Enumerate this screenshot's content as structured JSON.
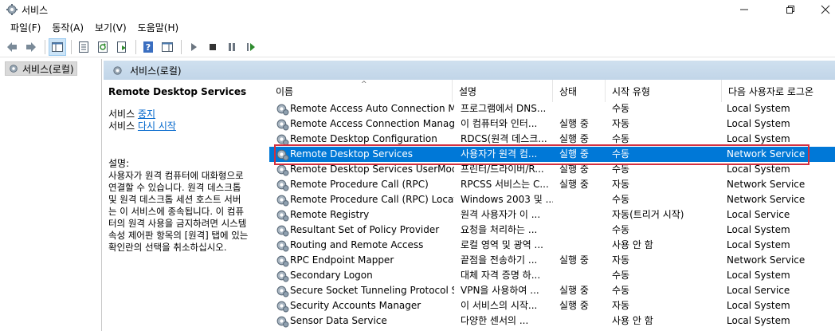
{
  "window": {
    "title": "서비스"
  },
  "menu": [
    "파일(F)",
    "동작(A)",
    "보기(V)",
    "도움말(H)"
  ],
  "tree": {
    "root_label": "서비스(로컬)"
  },
  "pane": {
    "header_label": "서비스(로컬)"
  },
  "description": {
    "service_name": "Remote Desktop Services",
    "stop_prefix": "서비스",
    "stop_link": "중지",
    "restart_prefix": "서비스",
    "restart_link": "다시 시작",
    "desc_label": "설명:",
    "desc_lines": [
      "사용자가 원격 컴퓨터에 대화형으로",
      "연결할 수 있습니다. 원격 데스크톱",
      "및 원격 데스크톱 세션 호스트 서버",
      "는 이 서비스에 종속됩니다. 이 컴퓨",
      "터의 원격 사용을 금지하려면 시스템",
      "속성 제어판 항목의 [원격] 탭에 있는",
      "확인란의 선택을 취소하십시오."
    ]
  },
  "columns": {
    "name": "이름",
    "description": "설명",
    "status": "상태",
    "startup": "시작 유형",
    "logon": "다음 사용자로 로그온"
  },
  "services": [
    {
      "name": "Remote Access Auto Connection M...",
      "description": "프로그램에서 DNS...",
      "status": "",
      "startup": "수동",
      "logon": "Local System"
    },
    {
      "name": "Remote Access Connection Manager",
      "description": "이 컴퓨터와 인터...",
      "status": "실행 중",
      "startup": "자동",
      "logon": "Local System"
    },
    {
      "name": "Remote Desktop Configuration",
      "description": "RDCS(원격 데스크...",
      "status": "실행 중",
      "startup": "수동",
      "logon": "Local System"
    },
    {
      "name": "Remote Desktop Services",
      "description": "사용자가 원격 컴...",
      "status": "실행 중",
      "startup": "수동",
      "logon": "Network Service",
      "selected": true
    },
    {
      "name": "Remote Desktop Services UserMode...",
      "description": "프린터/드라이버/R...",
      "status": "실행 중",
      "startup": "수동",
      "logon": "Local System"
    },
    {
      "name": "Remote Procedure Call (RPC)",
      "description": "RPCSS 서비스는 C...",
      "status": "실행 중",
      "startup": "자동",
      "logon": "Network Service"
    },
    {
      "name": "Remote Procedure Call (RPC) Locator",
      "description": "Windows 2003 및 ...",
      "status": "",
      "startup": "수동",
      "logon": "Network Service"
    },
    {
      "name": "Remote Registry",
      "description": "원격 사용자가 이 ...",
      "status": "",
      "startup": "자동(트리거 시작)",
      "logon": "Local Service"
    },
    {
      "name": "Resultant Set of Policy Provider",
      "description": "요청을 처리하는 ...",
      "status": "",
      "startup": "수동",
      "logon": "Local System"
    },
    {
      "name": "Routing and Remote Access",
      "description": "로컬 영역 및 광역 ...",
      "status": "",
      "startup": "사용 안 함",
      "logon": "Local System"
    },
    {
      "name": "RPC Endpoint Mapper",
      "description": "끝점을 전송하기 ...",
      "status": "실행 중",
      "startup": "자동",
      "logon": "Network Service"
    },
    {
      "name": "Secondary Logon",
      "description": "대체 자격 증명 하...",
      "status": "",
      "startup": "수동",
      "logon": "Local System"
    },
    {
      "name": "Secure Socket Tunneling Protocol S...",
      "description": "VPN을 사용하여 ...",
      "status": "실행 중",
      "startup": "수동",
      "logon": "Local Service"
    },
    {
      "name": "Security Accounts Manager",
      "description": "이 서비스의 시작...",
      "status": "실행 중",
      "startup": "자동",
      "logon": "Local System"
    },
    {
      "name": "Sensor Data Service",
      "description": "다양한 센서의 ...",
      "status": "",
      "startup": "사용 안 함",
      "logon": "Local System"
    }
  ],
  "icons": {
    "app": "services-gear-icon",
    "toolbar": [
      "back-arrow-icon",
      "forward-arrow-icon",
      "show-tree-icon",
      "properties-icon",
      "refresh-icon",
      "export-list-icon",
      "help-icon",
      "action-pane-icon",
      "play-icon",
      "stop-icon",
      "pause-icon",
      "resume-icon"
    ],
    "row": "service-gear-icon"
  },
  "colors": {
    "selection": "#0078d7",
    "highlight_box": "#d32f3f",
    "link": "#0066cc",
    "header_band": "#c8dcec"
  }
}
